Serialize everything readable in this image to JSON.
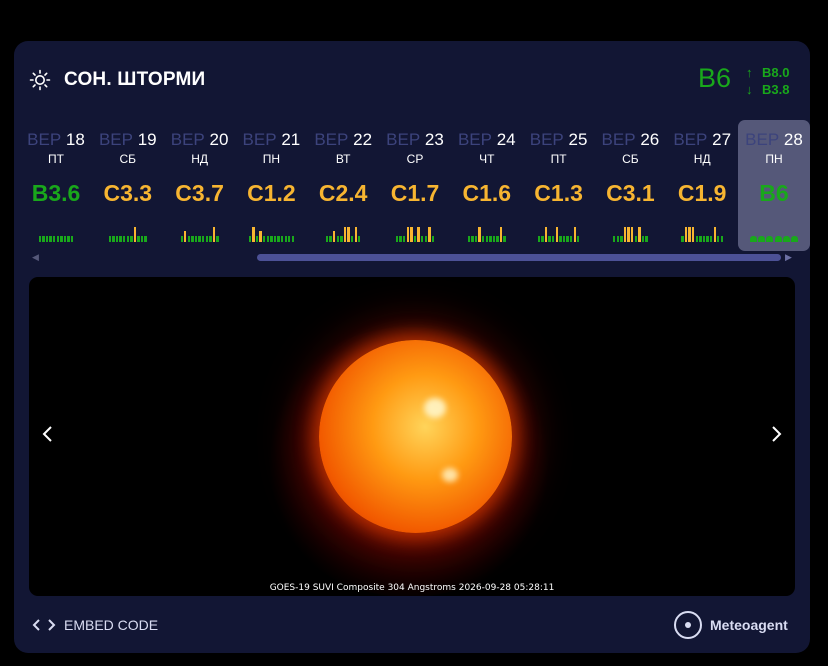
{
  "header": {
    "title": "СОН. ШТОРМИ",
    "current_class": "B6",
    "max": "B8.0",
    "min": "B3.8",
    "up_arrow": "↑",
    "down_arrow": "↓"
  },
  "days": [
    {
      "month": "ВЕР",
      "day": "18",
      "dow": "ПТ",
      "class": "B3.6",
      "level": "b"
    },
    {
      "month": "ВЕР",
      "day": "19",
      "dow": "СБ",
      "class": "C3.3",
      "level": "c"
    },
    {
      "month": "ВЕР",
      "day": "20",
      "dow": "НД",
      "class": "C3.7",
      "level": "c"
    },
    {
      "month": "ВЕР",
      "day": "21",
      "dow": "ПН",
      "class": "C1.2",
      "level": "c"
    },
    {
      "month": "ВЕР",
      "day": "22",
      "dow": "ВТ",
      "class": "C2.4",
      "level": "c"
    },
    {
      "month": "ВЕР",
      "day": "23",
      "dow": "СР",
      "class": "C1.7",
      "level": "c"
    },
    {
      "month": "ВЕР",
      "day": "24",
      "dow": "ЧТ",
      "class": "C1.6",
      "level": "c"
    },
    {
      "month": "ВЕР",
      "day": "25",
      "dow": "ПТ",
      "class": "C1.3",
      "level": "c"
    },
    {
      "month": "ВЕР",
      "day": "26",
      "dow": "СБ",
      "class": "C3.1",
      "level": "c"
    },
    {
      "month": "ВЕР",
      "day": "27",
      "dow": "НД",
      "class": "C1.9",
      "level": "c"
    },
    {
      "month": "ВЕР",
      "day": "28",
      "dow": "ПН",
      "class": "B6",
      "level": "b",
      "selected": true
    }
  ],
  "image": {
    "caption": "GOES-19 SUVI Composite 304 Angstroms 2026-09-28 05:28:11"
  },
  "footer": {
    "embed_label": "EMBED CODE",
    "brand": "Meteoagent"
  },
  "colors": {
    "accent_green": "#19a81b",
    "accent_yellow": "#f7b531",
    "card_bg": "#121634",
    "selected_bg": "#555879"
  },
  "icons": {
    "sun": "sun-icon",
    "prev": "chevron-left-icon",
    "next": "chevron-right-icon",
    "embed": "code-icon",
    "brand": "meteoagent-logo-icon"
  }
}
